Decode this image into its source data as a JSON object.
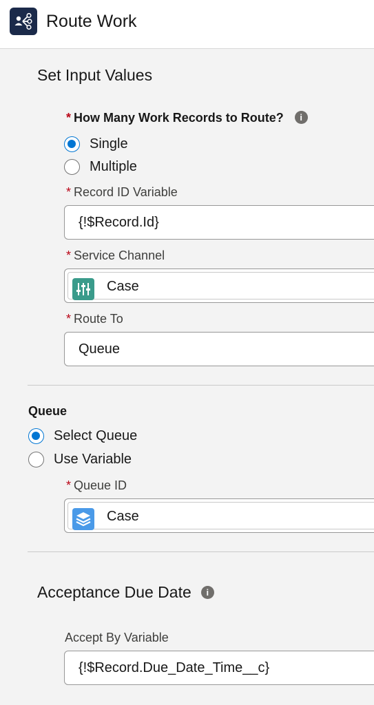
{
  "header": {
    "title": "Route Work",
    "icon": "route-work-icon",
    "icon_color": "#1b2a4a"
  },
  "input_values": {
    "title": "Set Input Values",
    "how_many": {
      "label": "How Many Work Records to Route?",
      "options": [
        {
          "label": "Single",
          "checked": true
        },
        {
          "label": "Multiple",
          "checked": false
        }
      ]
    },
    "record_id": {
      "label": "Record ID Variable",
      "value": "{!$Record.Id}"
    },
    "service_channel": {
      "label": "Service Channel",
      "value": "Case",
      "icon": "service-channel-icon",
      "icon_color": "#3a9b8b"
    },
    "route_to": {
      "label": "Route To",
      "value": "Queue"
    }
  },
  "queue": {
    "title": "Queue",
    "options": [
      {
        "label": "Select Queue",
        "checked": true
      },
      {
        "label": "Use Variable",
        "checked": false
      }
    ],
    "queue_id": {
      "label": "Queue ID",
      "value": "Case",
      "icon": "queue-stack-icon",
      "icon_color": "#4a9ae8"
    }
  },
  "due_date": {
    "title": "Acceptance Due Date",
    "accept_by": {
      "label": "Accept By Variable",
      "value": "{!$Record.Due_Date_Time__c}"
    }
  },
  "colors": {
    "accent": "#0176d3",
    "required": "#ba0517"
  },
  "symbols": {
    "required": "*",
    "info": "i"
  }
}
